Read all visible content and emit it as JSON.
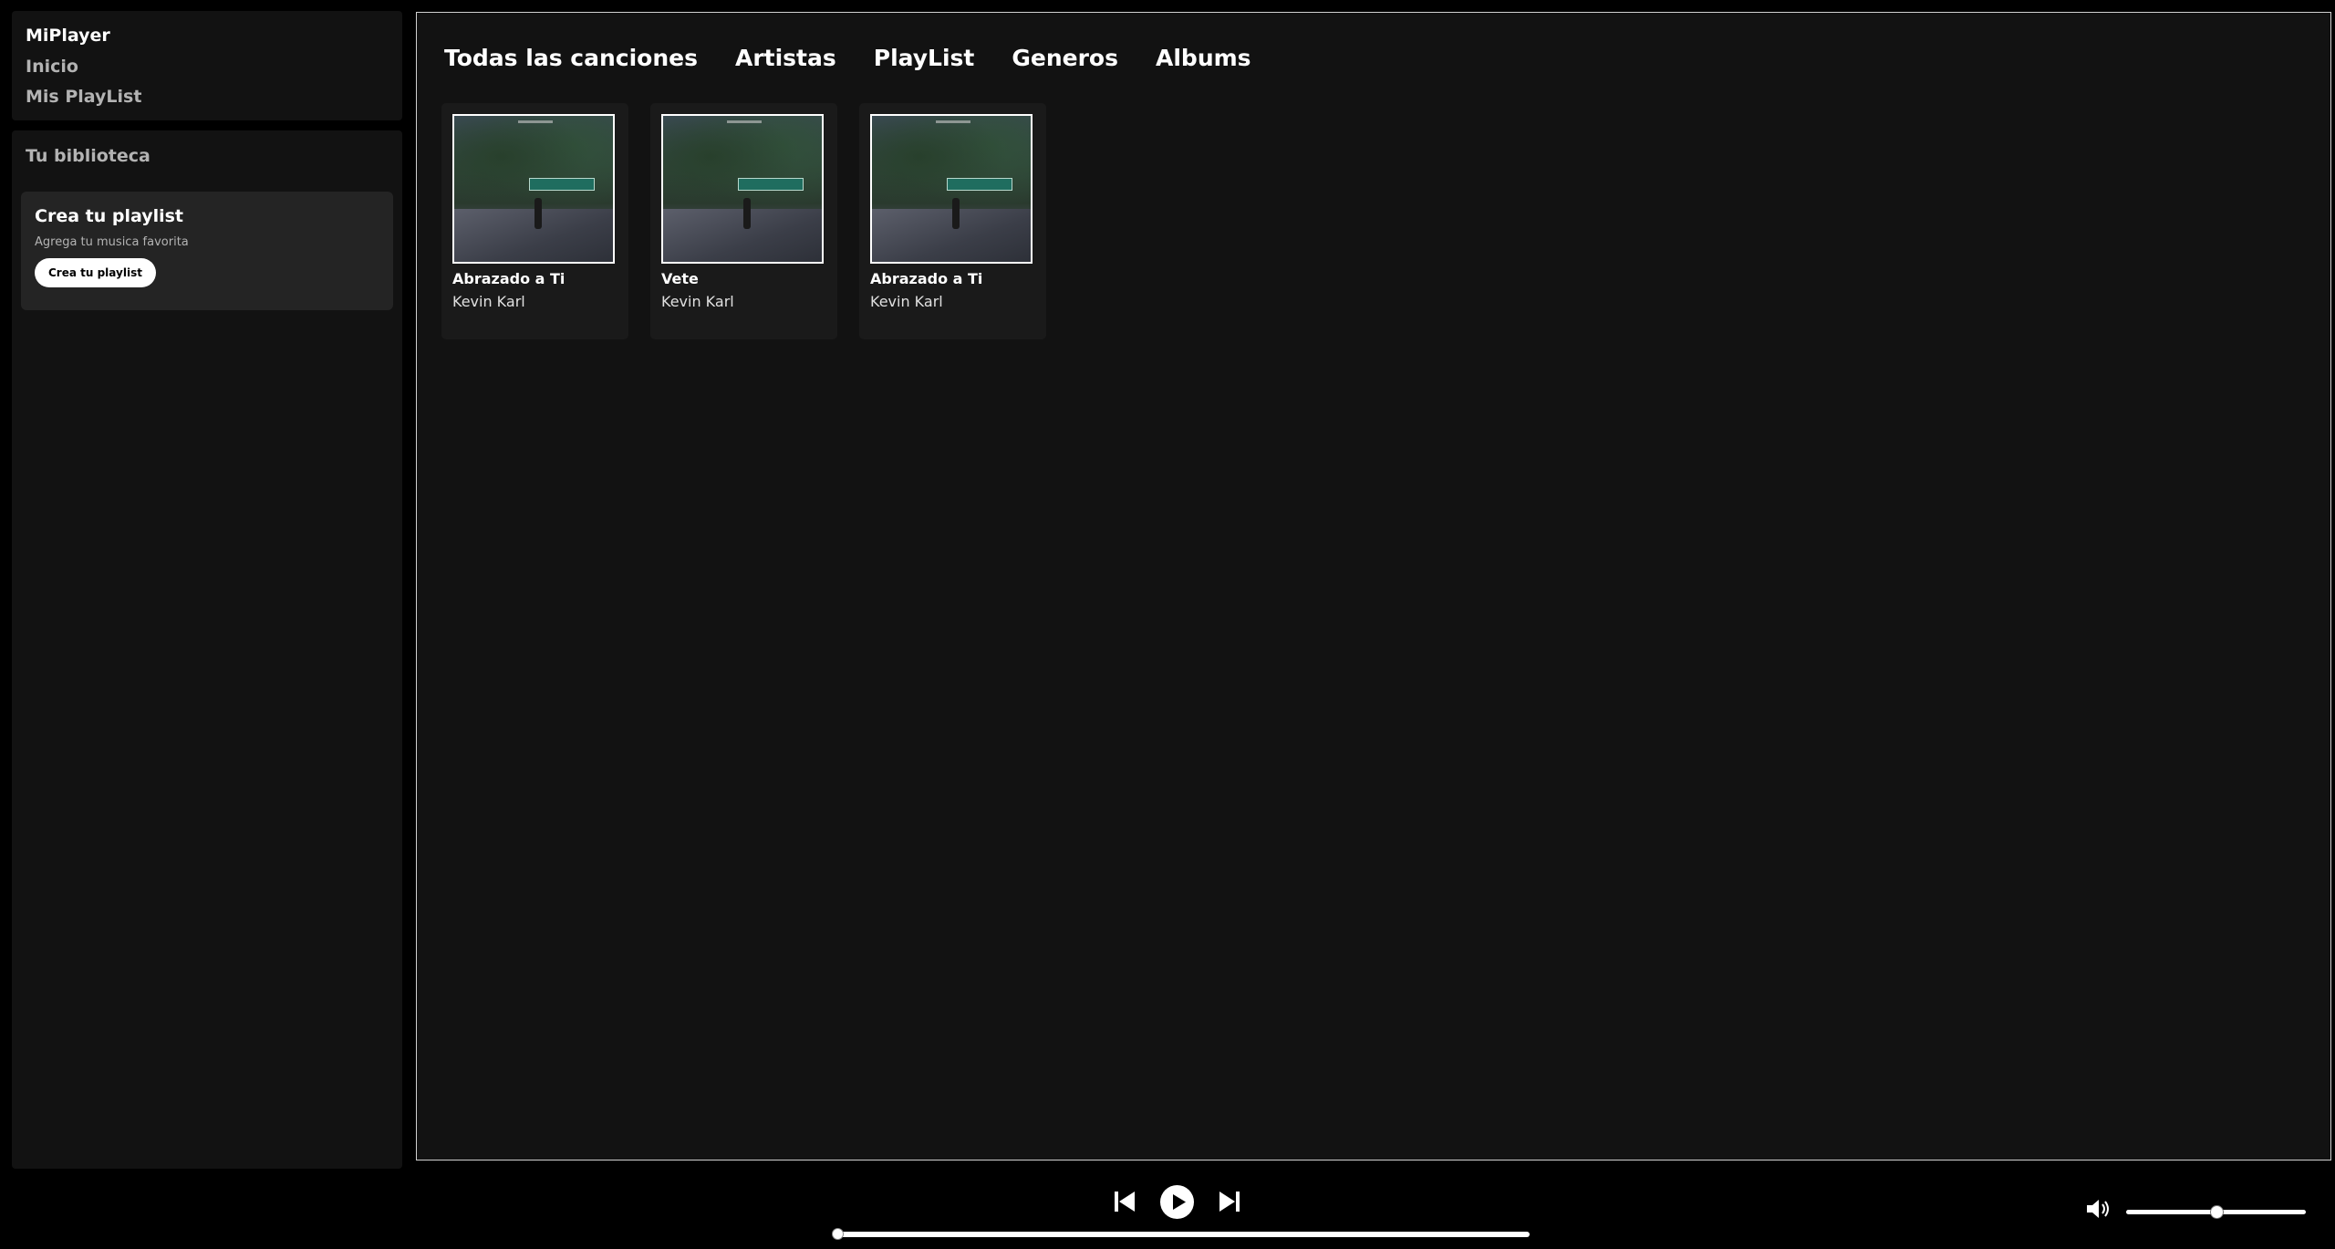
{
  "sidebar": {
    "brand": "MiPlayer",
    "links": [
      "Inicio",
      "Mis PlayList"
    ],
    "library_title": "Tu biblioteca",
    "create": {
      "title": "Crea tu playlist",
      "subtitle": "Agrega tu musica favorita",
      "button": "Crea tu playlist"
    }
  },
  "main": {
    "tabs": [
      "Todas las canciones",
      "Artistas",
      "PlayList",
      "Generos",
      "Albums"
    ],
    "songs": [
      {
        "title": "Abrazado a Ti",
        "artist": "Kevin Karl"
      },
      {
        "title": "Vete",
        "artist": "Kevin Karl"
      },
      {
        "title": "Abrazado a Ti",
        "artist": "Kevin Karl"
      }
    ]
  },
  "player": {
    "icons": [
      "previous-icon",
      "play-icon",
      "next-icon",
      "volume-icon"
    ],
    "progress_fraction": 0.0,
    "volume_fraction": 0.5
  }
}
